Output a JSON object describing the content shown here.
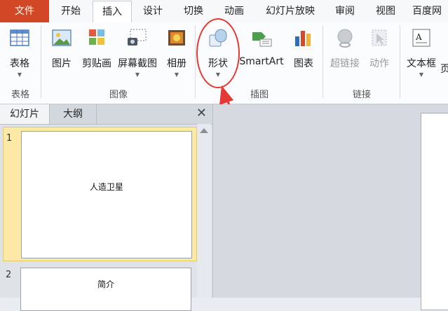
{
  "tabs": [
    "文件",
    "开始",
    "插入",
    "设计",
    "切换",
    "动画",
    "幻灯片放映",
    "审阅",
    "视图",
    "百度网"
  ],
  "ribbon": {
    "table": {
      "label": "表格",
      "group": "表格"
    },
    "picture": {
      "label": "图片"
    },
    "clipart": {
      "label": "剪贴画"
    },
    "screenshot": {
      "label": "屏幕截图"
    },
    "album": {
      "label": "相册"
    },
    "image_group": "图像",
    "shapes": {
      "label": "形状"
    },
    "smartart": {
      "label": "SmartArt"
    },
    "chart": {
      "label": "图表"
    },
    "illustration_group": "插图",
    "hyperlink": {
      "label": "超链接"
    },
    "action": {
      "label": "动作"
    },
    "link_group": "链接",
    "textbox": {
      "label": "文本框"
    },
    "page_fragment": "页"
  },
  "pane": {
    "tab_slides": "幻灯片",
    "tab_outline": "大纲",
    "close": "✕",
    "slides": [
      {
        "num": "1",
        "title": "人造卫星"
      },
      {
        "num": "2",
        "title": "简介"
      }
    ]
  },
  "colors": {
    "file_tab": "#d24726",
    "annotation": "#e53935",
    "selected_slide": "#fde9a6"
  }
}
